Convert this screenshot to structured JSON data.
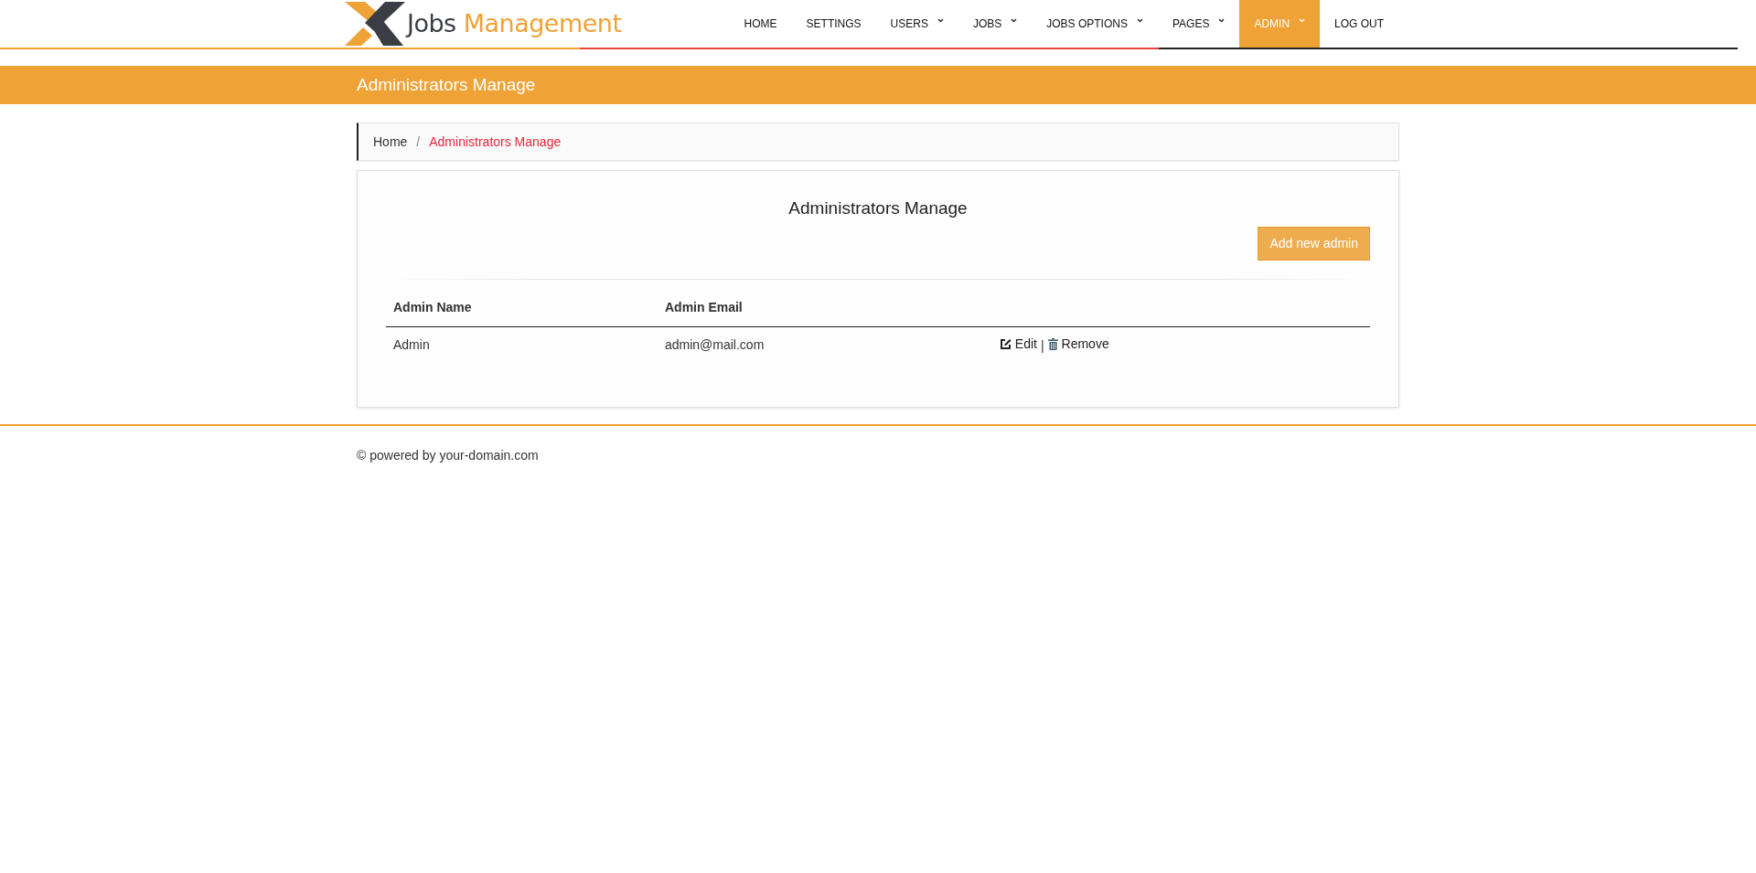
{
  "logo": {
    "text_dark": "Jobs",
    "text_accent": "Management"
  },
  "nav": [
    {
      "label": "HOME",
      "dropdown": false,
      "selected": false
    },
    {
      "label": "SETTINGS",
      "dropdown": false,
      "selected": false
    },
    {
      "label": "USERS",
      "dropdown": true,
      "selected": false
    },
    {
      "label": "JOBS",
      "dropdown": true,
      "selected": false
    },
    {
      "label": "JOBS OPTIONS",
      "dropdown": true,
      "selected": false
    },
    {
      "label": "PAGES",
      "dropdown": true,
      "selected": false
    },
    {
      "label": "ADMIN",
      "dropdown": true,
      "selected": true
    },
    {
      "label": "LOG OUT",
      "dropdown": false,
      "selected": false
    }
  ],
  "banner": {
    "title": "Administrators Manage"
  },
  "breadcrumb_separator": "/",
  "breadcrumb": [
    {
      "label": "Home",
      "selected": false
    },
    {
      "label": "Administrators Manage",
      "selected": true
    }
  ],
  "panel": {
    "title": "Administrators Manage",
    "add_button": "Add new admin",
    "table": {
      "columns": [
        "Admin Name",
        "Admin Email"
      ],
      "rows": [
        {
          "cells": [
            "Admin",
            "admin@mail.com"
          ],
          "edit": "Edit",
          "separator": "|",
          "remove": "Remove"
        }
      ]
    }
  },
  "footer": {
    "text": "© powered by your-domain.com"
  }
}
